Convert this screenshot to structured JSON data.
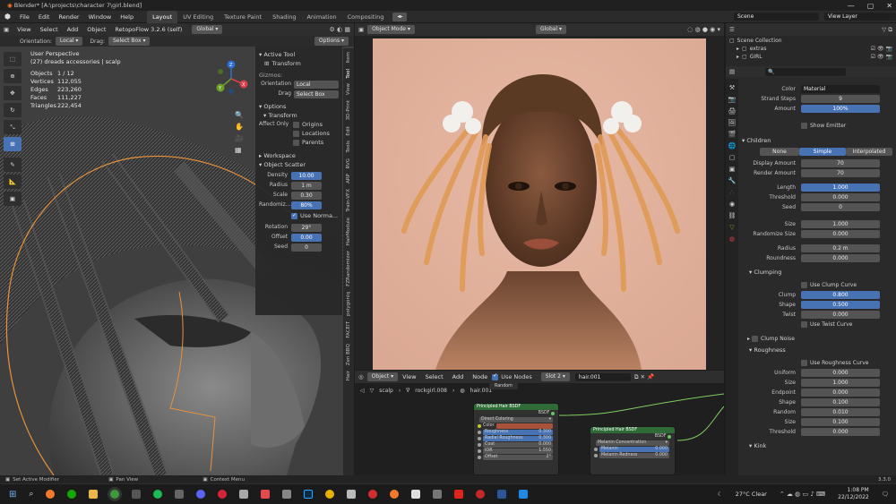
{
  "title_bar": {
    "title": "Blender* [A:\\projects\\character 7\\girl.blend]",
    "controls": [
      "—",
      "▢",
      "✕"
    ]
  },
  "menu": {
    "items": [
      "File",
      "Edit",
      "Render",
      "Window",
      "Help"
    ],
    "workspaces": [
      "Layout",
      "UV Editing",
      "Texture Paint",
      "Shading",
      "Animation",
      "Compositing"
    ],
    "scene_label": "Scene",
    "view_layer_label": "View Layer"
  },
  "viewport_left": {
    "header": {
      "mode": "View",
      "items": [
        "View",
        "Select",
        "Add",
        "Object"
      ],
      "addon": "RetopoFlow 3.2.6 (self)",
      "transform": "Global"
    },
    "tool_settings": {
      "orientation_label": "Orientation:",
      "orientation": "Local",
      "drag_label": "Drag:",
      "drag": "Select Box",
      "options": "Options"
    },
    "overlay": {
      "view_name": "User Perspective",
      "context": "(27) dreads accessories | scalp",
      "stats": [
        [
          "Objects",
          "1 / 12"
        ],
        [
          "Vertices",
          "112,055"
        ],
        [
          "Edges",
          "223,260"
        ],
        [
          "Faces",
          "111,227"
        ],
        [
          "Triangles",
          "222,454"
        ]
      ]
    },
    "n_panel": {
      "active_tool": "Active Tool",
      "transform_tool": "Transform",
      "gizmos": "Gizmos:",
      "orientation_label": "Orientation",
      "orientation": "Local",
      "drag_label": "Drag",
      "drag": "Select Box",
      "options": "Options",
      "transform": "Transform",
      "affect_only": "Affect Only",
      "affect_items": [
        "Origins",
        "Locations",
        "Parents"
      ],
      "workspace": "Workspace",
      "object_scatter": "Object Scatter",
      "scatter": [
        [
          "Density",
          "10.00"
        ],
        [
          "Radius",
          "1 m"
        ],
        [
          "Scale",
          "0.30"
        ],
        [
          "Randomiz...",
          "80%"
        ]
      ],
      "use_normal": "Use Norma...",
      "scatter2": [
        [
          "Rotation",
          "29°"
        ],
        [
          "Offset",
          "0.00"
        ],
        [
          "Seed",
          "0"
        ]
      ]
    },
    "side_tabs": [
      "Item",
      "Tool",
      "View",
      "3D-Print",
      "Edit",
      "Tools",
      "RVG",
      "ARP",
      "Train-VFX",
      "HairModule",
      "FZRandomizer",
      "polygoniq",
      "FACEIT",
      "Zen BBQ",
      "Hair"
    ]
  },
  "viewport_render": {
    "header": {
      "mode": "Object Mode",
      "transform": "Global"
    }
  },
  "node_editor": {
    "header": {
      "editor": "Object",
      "items": [
        "View",
        "Select",
        "Add",
        "Node"
      ],
      "use_nodes": "Use Nodes",
      "slot": "Slot 2",
      "material": "hair.001"
    },
    "breadcrumb": [
      "scalp",
      "rockgirl.008",
      "hair.001"
    ],
    "random_label": "Random",
    "node1": {
      "title": "Principled Hair BSDF",
      "output": "BSDF",
      "coloring": "Direct Coloring",
      "rows": [
        [
          "Color",
          ""
        ],
        [
          "Roughness",
          "0.300"
        ],
        [
          "Radial Roughness",
          "0.300"
        ],
        [
          "Coat",
          "0.000"
        ],
        [
          "IOR",
          "1.550"
        ],
        [
          "Offset",
          "2°"
        ]
      ]
    },
    "node2": {
      "title": "Principled Hair BSDF",
      "output": "BSDF",
      "coloring": "Melanin Concentration",
      "rows": [
        [
          "Melanin",
          "0.000"
        ],
        [
          "Melanin Redness",
          "0.000"
        ]
      ]
    }
  },
  "outliner": {
    "items": [
      "Scene Collection",
      "extras",
      "GIRL"
    ]
  },
  "properties": {
    "top": [
      [
        "Color",
        "Material"
      ],
      [
        "Strand Steps",
        "9"
      ],
      [
        "Amount",
        "100%"
      ]
    ],
    "show_emitter": "Show Emitter",
    "children": "Children",
    "child_modes": [
      "None",
      "Simple",
      "Interpolated"
    ],
    "children_fields": [
      [
        "Display Amount",
        "70"
      ],
      [
        "Render Amount",
        "70"
      ]
    ],
    "fields1": [
      [
        "Length",
        "1.000"
      ],
      [
        "Threshold",
        "0.000"
      ],
      [
        "Seed",
        "0"
      ]
    ],
    "fields2": [
      [
        "Size",
        "1.000"
      ],
      [
        "Randomize Size",
        "0.000"
      ]
    ],
    "fields3": [
      [
        "Radius",
        "0.2 m"
      ],
      [
        "Roundness",
        "0.000"
      ]
    ],
    "clumping": "Clumping",
    "use_clump_curve": "Use Clump Curve",
    "clump_fields": [
      [
        "Clump",
        "0.800"
      ],
      [
        "Shape",
        "0.500"
      ],
      [
        "Twist",
        "0.000"
      ]
    ],
    "use_twist_curve": "Use Twist Curve",
    "clump_noise": "Clump Noise",
    "roughness": "Roughness",
    "use_roughness_curve": "Use Roughness Curve",
    "rough_fields": [
      [
        "Uniform",
        "0.000"
      ],
      [
        "Size",
        "1.000"
      ],
      [
        "Endpoint",
        "0.000"
      ],
      [
        "Shape",
        "0.100"
      ],
      [
        "Random",
        "0.010"
      ],
      [
        "Size",
        "0.100"
      ],
      [
        "Threshold",
        "0.000"
      ]
    ],
    "kink": "Kink"
  },
  "status": {
    "left": "Set Active Modifier",
    "middle": "Pan View",
    "right": "Context Menu",
    "version": "3.3.0"
  },
  "taskbar": {
    "weather": "27°C  Clear",
    "time": "1:08 PM",
    "date": "22/12/2022"
  },
  "colors": {
    "accent": "#4772b3",
    "selection": "#e8923a",
    "node_header": "#2e6b36"
  }
}
